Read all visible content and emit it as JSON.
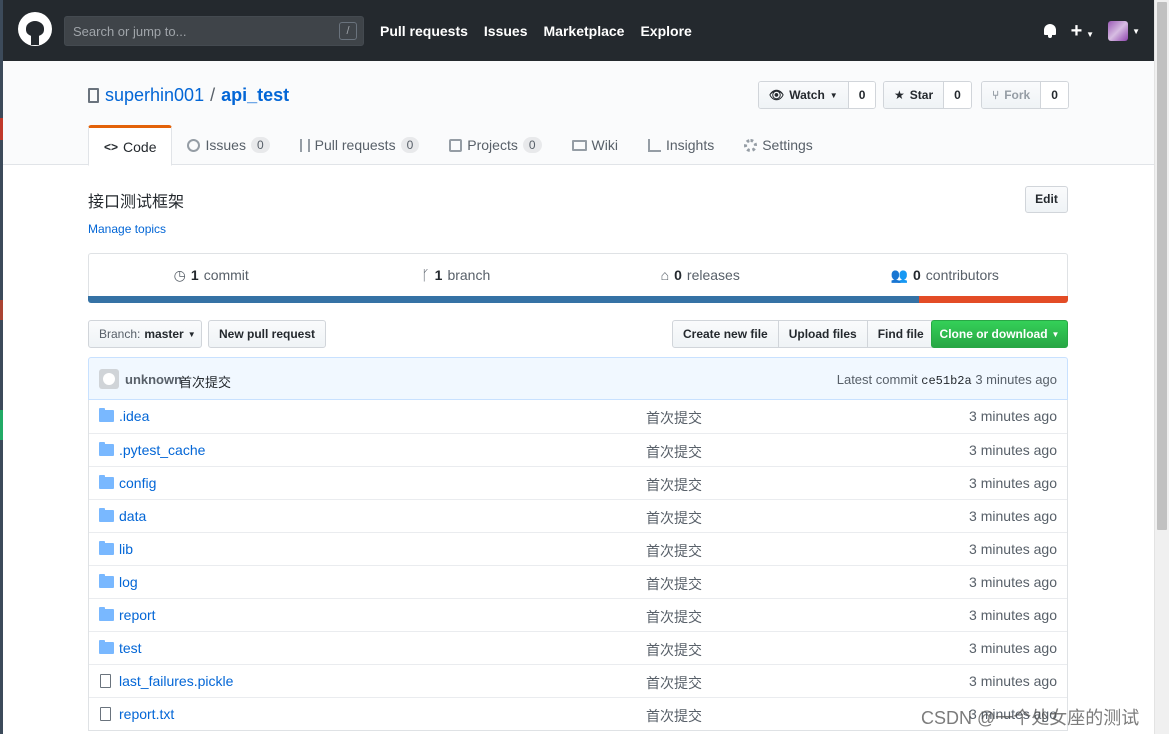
{
  "header": {
    "search_placeholder": "Search or jump to...",
    "search_shortcut": "/",
    "nav": [
      "Pull requests",
      "Issues",
      "Marketplace",
      "Explore"
    ],
    "plus_label": "+"
  },
  "repo": {
    "owner": "superhin001",
    "separator": "/",
    "name": "api_test",
    "watch": {
      "label": "Watch",
      "count": "0"
    },
    "star": {
      "label": "Star",
      "count": "0"
    },
    "fork": {
      "label": "Fork",
      "count": "0"
    },
    "tabs": [
      {
        "label": "Code",
        "count": null
      },
      {
        "label": "Issues",
        "count": "0"
      },
      {
        "label": "Pull requests",
        "count": "0"
      },
      {
        "label": "Projects",
        "count": "0"
      },
      {
        "label": "Wiki",
        "count": null
      },
      {
        "label": "Insights",
        "count": null
      },
      {
        "label": "Settings",
        "count": null
      }
    ],
    "selected_tab": "Code",
    "description": "接口测试框架",
    "manage_topics": "Manage topics",
    "edit_label": "Edit"
  },
  "summary": {
    "commits": {
      "num": "1",
      "label": "commit"
    },
    "branches": {
      "num": "1",
      "label": "branch"
    },
    "releases": {
      "num": "0",
      "label": "releases"
    },
    "contributors": {
      "num": "0",
      "label": "contributors"
    },
    "languages": [
      {
        "color": "#3572A5",
        "share": 0.848
      },
      {
        "color": "#e34c26",
        "share": 0.152
      }
    ]
  },
  "file_nav": {
    "branch_label": "Branch:",
    "branch_value": "master",
    "new_pr": "New pull request",
    "create_file": "Create new file",
    "upload_files": "Upload files",
    "find_file": "Find file",
    "clone": "Clone or download"
  },
  "latest_commit": {
    "author": "unknown",
    "message": "首次提交",
    "prefix": "Latest commit",
    "sha": "ce51b2a",
    "age": "3 minutes ago"
  },
  "files": [
    {
      "type": "folder",
      "name": ".idea",
      "message": "首次提交",
      "age": "3 minutes ago"
    },
    {
      "type": "folder",
      "name": ".pytest_cache",
      "message": "首次提交",
      "age": "3 minutes ago"
    },
    {
      "type": "folder",
      "name": "config",
      "message": "首次提交",
      "age": "3 minutes ago"
    },
    {
      "type": "folder",
      "name": "data",
      "message": "首次提交",
      "age": "3 minutes ago"
    },
    {
      "type": "folder",
      "name": "lib",
      "message": "首次提交",
      "age": "3 minutes ago"
    },
    {
      "type": "folder",
      "name": "log",
      "message": "首次提交",
      "age": "3 minutes ago"
    },
    {
      "type": "folder",
      "name": "report",
      "message": "首次提交",
      "age": "3 minutes ago"
    },
    {
      "type": "folder",
      "name": "test",
      "message": "首次提交",
      "age": "3 minutes ago"
    },
    {
      "type": "file",
      "name": "last_failures.pickle",
      "message": "首次提交",
      "age": "3 minutes ago"
    },
    {
      "type": "file",
      "name": "report.txt",
      "message": "首次提交",
      "age": "3 minutes ago"
    }
  ],
  "watermark": "CSDN @一个处女座的测试"
}
